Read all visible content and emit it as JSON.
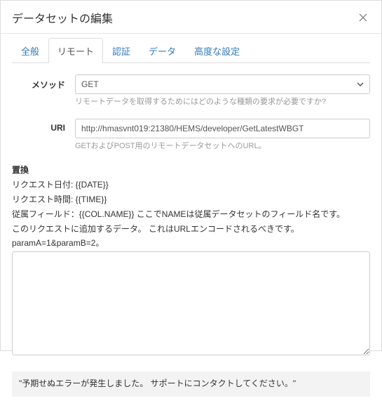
{
  "header": {
    "title": "データセットの編集"
  },
  "tabs": {
    "general": "全般",
    "remote": "リモート",
    "auth": "認証",
    "data": "データ",
    "advanced": "高度な設定"
  },
  "method": {
    "label": "メソッド",
    "value": "GET",
    "help": "リモートデータを取得するためにはどのような種類の要求が必要ですか?"
  },
  "uri": {
    "label": "URI",
    "value": "http://hmasvnt019:21380/HEMS/developer/GetLatestWBGT",
    "help": "GETおよびPOST用のリモートデータセットへのURL。"
  },
  "replace": {
    "label": "置換",
    "line1": "リクエスト日付: {{DATE}}",
    "line2": "リクエスト時間: {{TIME}}",
    "line3": "従属フィールド：{{COL.NAME}} ここでNAMEは従属データセットのフィールド名です。",
    "desc": "このリクエストに追加するデータ。 これはURLエンコードされるべきです。 paramA=1&paramB=2。",
    "textarea_value": ""
  },
  "error": {
    "message": "\"予期せぬエラーが発生しました。 サポートにコンタクトしてください。\""
  }
}
